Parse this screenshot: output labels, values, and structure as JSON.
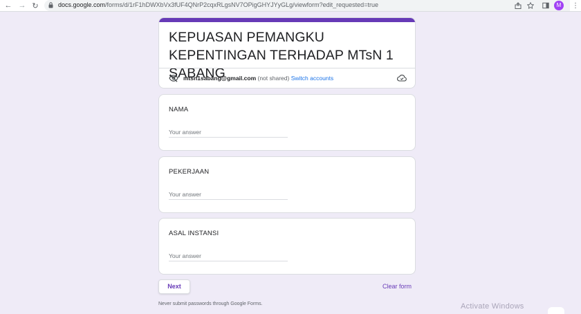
{
  "browser": {
    "url_host": "docs.google.com",
    "url_path": "/forms/d/1rF1hDWXbVx3fUF4QNrP2cqxRLgsNV7OPigGHYJYyGLg/viewform?edit_requested=true",
    "avatar_letter": "M",
    "avatar_color": "#a142f4"
  },
  "form": {
    "accent_color": "#673ab7",
    "title": "KEPUASAN PEMANGKU KEPENTINGAN TERHADAP MTsN 1 SABANG",
    "account": {
      "email": "mtsn1sabang@gmail.com",
      "note": "(not shared)",
      "switch_label": "Switch accounts"
    },
    "questions": [
      {
        "label": "NAMA",
        "placeholder": "Your answer"
      },
      {
        "label": "PEKERJAAN",
        "placeholder": "Your answer"
      },
      {
        "label": "ASAL INSTANSI",
        "placeholder": "Your answer"
      }
    ],
    "next_label": "Next",
    "clear_label": "Clear form",
    "footer_note": "Never submit passwords through Google Forms."
  },
  "watermark": "Activate Windows"
}
